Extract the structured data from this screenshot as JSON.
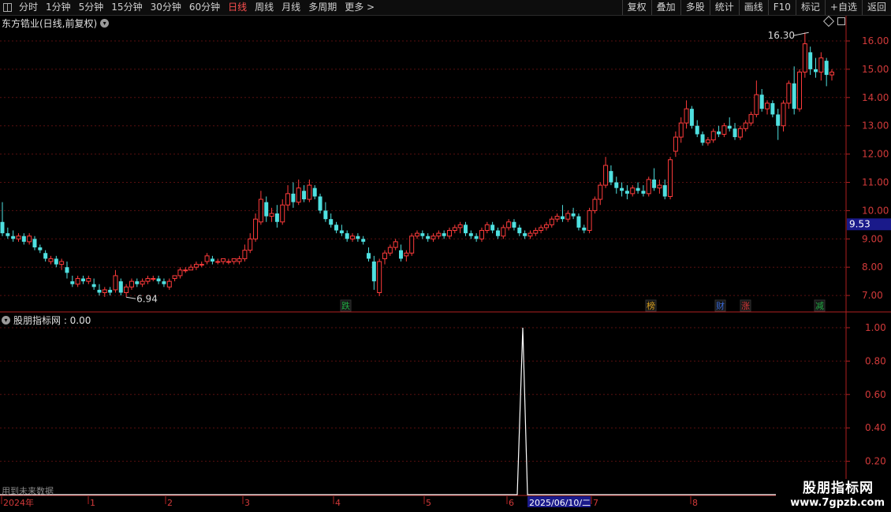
{
  "toolbar": {
    "periods": [
      "分时",
      "1分钟",
      "5分钟",
      "15分钟",
      "30分钟",
      "60分钟",
      "日线",
      "周线",
      "月线",
      "多周期",
      "更多 >"
    ],
    "active_period": "日线",
    "actions": [
      "复权",
      "叠加",
      "多股",
      "统计",
      "画线",
      "F10",
      "+自选",
      "返回"
    ],
    "mark_label": "标记"
  },
  "chart": {
    "title": "东方锆业(日线,前复权)",
    "price_axis": [
      "16.00",
      "15.00",
      "14.00",
      "13.00",
      "12.00",
      "11.00",
      "10.00",
      "9.00",
      "8.00",
      "7.00"
    ],
    "current_price": "9.53",
    "high_label": "16.30",
    "low_label": "6.94",
    "event_tags": [
      {
        "text": "跌",
        "color": "#22aa44"
      },
      {
        "text": "榜",
        "color": "#d8a020"
      },
      {
        "text": "财",
        "color": "#3a6ad8"
      },
      {
        "text": "涨",
        "color": "#d83a3a"
      },
      {
        "text": "减",
        "color": "#22aa44"
      }
    ],
    "up_color": "#ff3b3b",
    "down_color": "#4fe0e0"
  },
  "indicator": {
    "title": "股朋指标网 : 0.00",
    "axis": [
      "1.00",
      "0.80",
      "0.60",
      "0.40",
      "0.20"
    ],
    "peak_value": 1.0
  },
  "timeline": {
    "labels": [
      "2024年",
      "1",
      "2",
      "3",
      "4",
      "5",
      "6",
      "7",
      "8"
    ],
    "cursor_date": "2025/06/10/二"
  },
  "footer_note": "用到未来数据",
  "watermark": {
    "name": "股朋指标网",
    "url": "www.7gpzb.com"
  }
}
